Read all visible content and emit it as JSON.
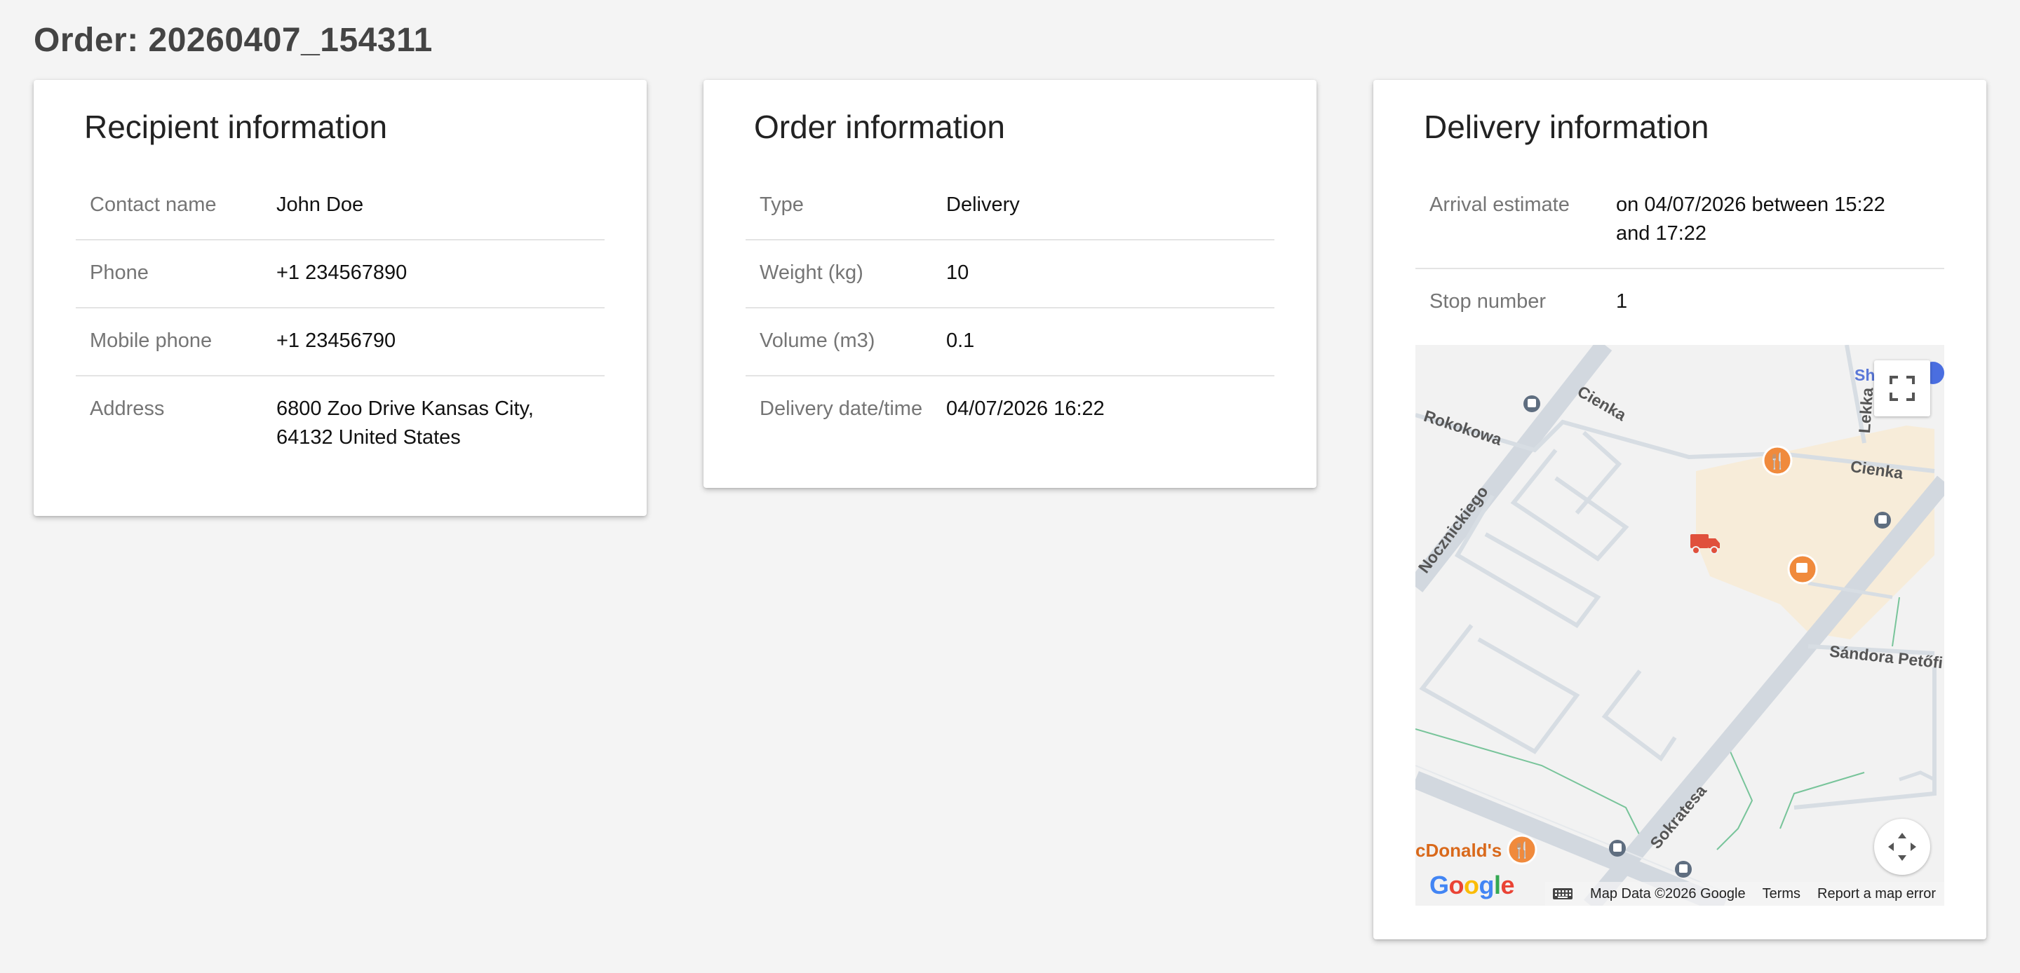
{
  "page": {
    "title": "Order: 20260407_154311"
  },
  "recipient": {
    "title": "Recipient information",
    "rows": [
      {
        "label": "Contact name",
        "value": "John Doe"
      },
      {
        "label": "Phone",
        "value": "+1 234567890"
      },
      {
        "label": "Mobile phone",
        "value": "+1 23456790"
      },
      {
        "label": "Address",
        "value": "6800 Zoo Drive Kansas City,\n64132 United States"
      }
    ]
  },
  "order": {
    "title": "Order information",
    "rows": [
      {
        "label": "Type",
        "value": "Delivery"
      },
      {
        "label": "Weight (kg)",
        "value": "10"
      },
      {
        "label": "Volume (m3)",
        "value": "0.1"
      },
      {
        "label": "Delivery date/time",
        "value": "04/07/2026 16:22"
      }
    ]
  },
  "delivery": {
    "title": "Delivery information",
    "rows": [
      {
        "label": "Arrival estimate",
        "value": "on 04/07/2026 between 15:22\nand 17:22"
      },
      {
        "label": "Stop number",
        "value": "1"
      }
    ],
    "map": {
      "streets": {
        "rokokowa": "Rokokowa",
        "cienka_top": "Cienka",
        "cienka_right": "Cienka",
        "lekka": "Lekka",
        "nocznickiego": "Nocznickiego",
        "sokratesa": "Sokratesa",
        "sandora": "Sándora Petőfi",
        "sh": "Sh"
      },
      "poi_mcdonalds": "cDonald's",
      "google_logo": [
        "G",
        "o",
        "o",
        "g",
        "l",
        "e"
      ],
      "google_colors": [
        "#4285F4",
        "#EA4335",
        "#FBBC05",
        "#4285F4",
        "#34A853",
        "#EA4335"
      ],
      "footer": {
        "map_data": "Map Data ©2026 Google",
        "terms": "Terms",
        "report": "Report a map error"
      },
      "icons": {
        "fullscreen": "fullscreen-icon",
        "pan": "pan-control-icon",
        "truck": "truck-icon",
        "keyboard": "keyboard-icon"
      },
      "colors": {
        "truck": "#e0503c",
        "poi": "#f08a3c",
        "road": "#d5dbe2",
        "commercial": "#f7ecd9"
      }
    }
  }
}
